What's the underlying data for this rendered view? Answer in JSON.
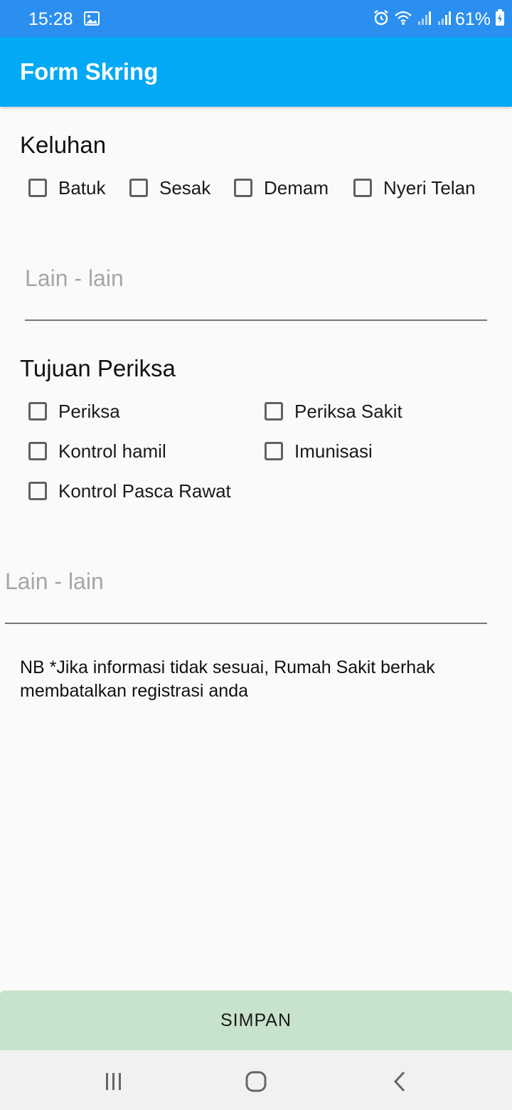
{
  "status_bar": {
    "time": "15:28",
    "battery": "61%",
    "icons": [
      "gallery-icon",
      "alarm-icon",
      "wifi-icon",
      "signal-icon",
      "signal-icon",
      "battery-icon"
    ]
  },
  "app_bar": {
    "title": "Form Skring"
  },
  "keluhan": {
    "title": "Keluhan",
    "options": [
      "Batuk",
      "Sesak",
      "Demam",
      "Nyeri Telan"
    ],
    "other_placeholder": "Lain - lain"
  },
  "tujuan": {
    "title": "Tujuan Periksa",
    "options": [
      "Periksa",
      "Periksa Sakit",
      "Kontrol hamil",
      "Imunisasi",
      "Kontrol Pasca Rawat"
    ],
    "other_placeholder": "Lain - lain"
  },
  "note": "NB *Jika informasi tidak sesuai, Rumah Sakit berhak membatalkan registrasi anda",
  "save_button": {
    "label": "SIMPAN"
  },
  "colors": {
    "status_bar": "#2b8ff0",
    "app_bar": "#03a9f4",
    "save_button": "#c8e3cb",
    "background": "#fafafa"
  }
}
